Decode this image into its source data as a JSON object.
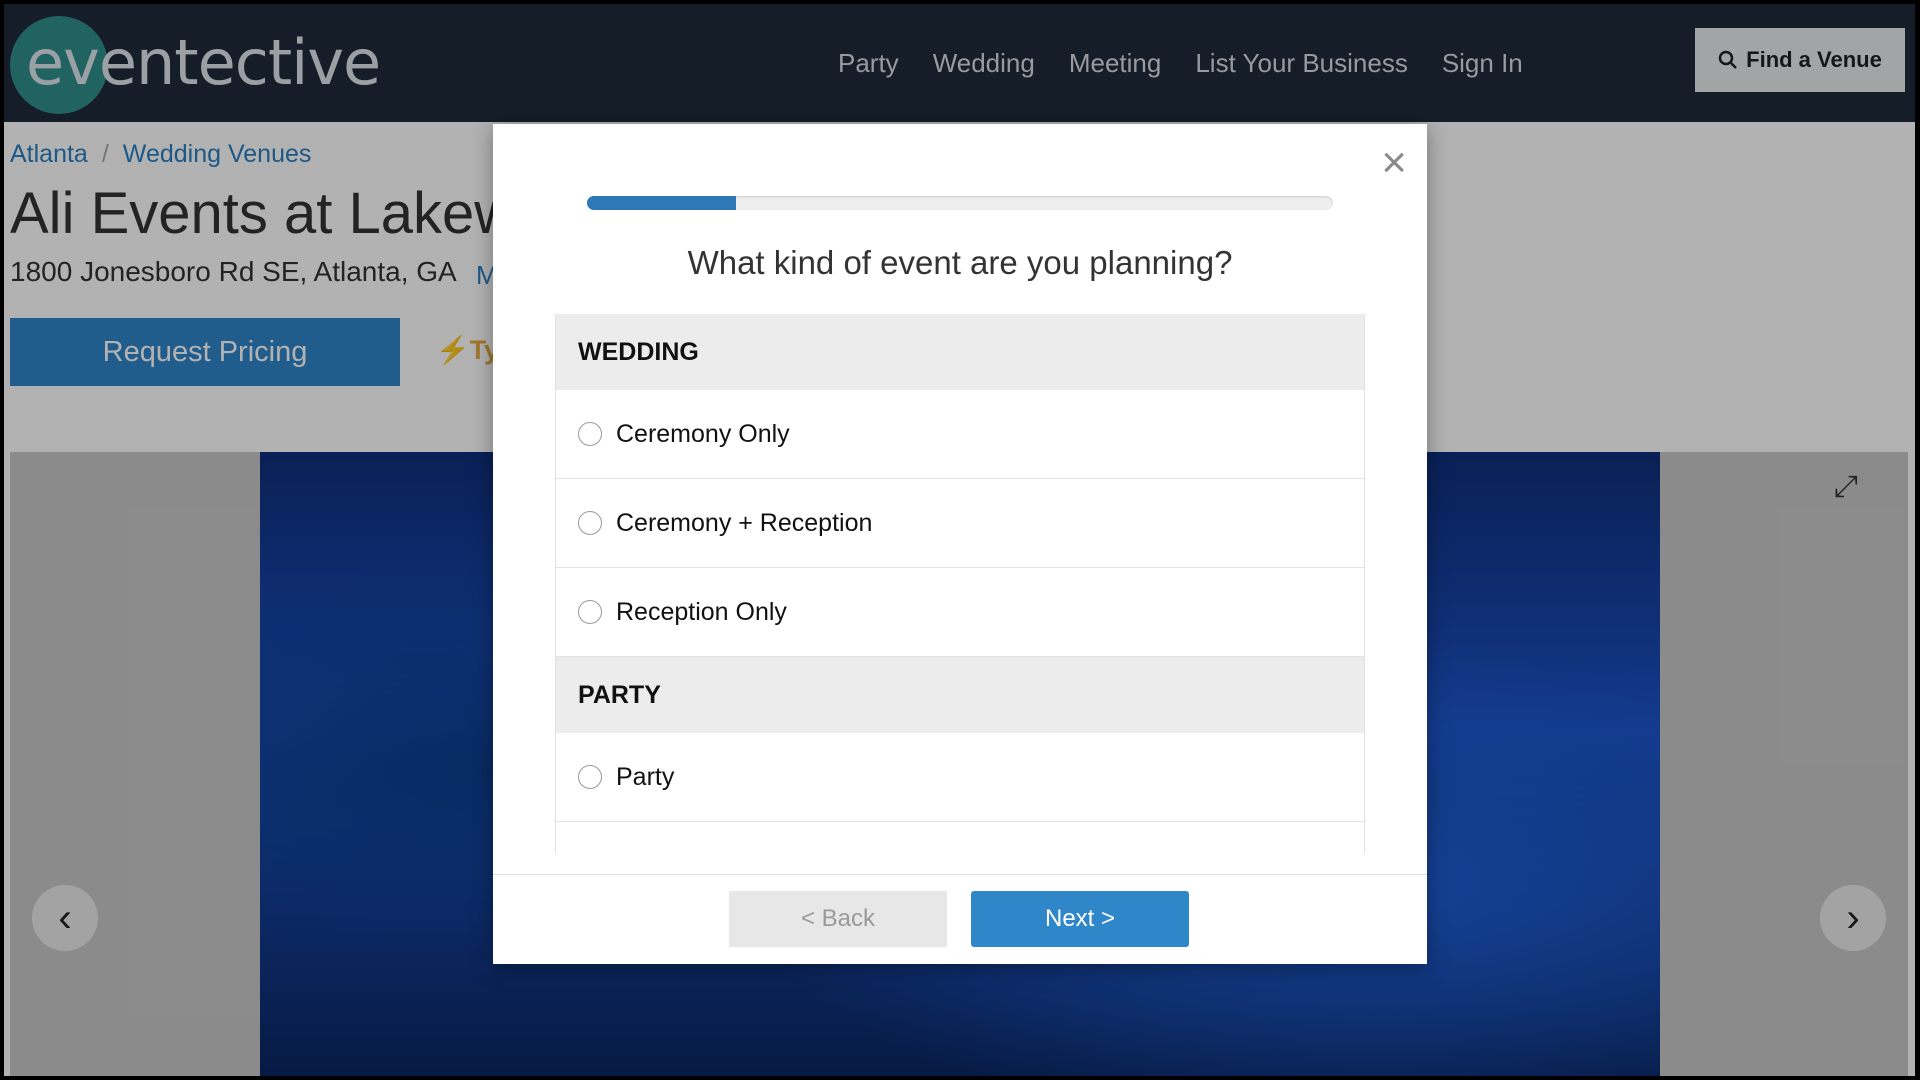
{
  "brand": {
    "logo_text": "eventective",
    "accent": "#2f8f8a"
  },
  "nav": {
    "items": [
      "Party",
      "Wedding",
      "Meeting",
      "List Your Business",
      "Sign In"
    ],
    "find_label": "Find a Venue"
  },
  "breadcrumb": {
    "items": [
      "Atlanta",
      "Wedding Venues"
    ],
    "separator": "/"
  },
  "venue": {
    "title": "Ali Events at Lakewo",
    "address": "1800 Jonesboro Rd SE, Atlanta, GA",
    "map_fragment": "M",
    "request_label": "Request Pricing",
    "typ_label": "Typ"
  },
  "modal": {
    "close_label": "×",
    "progress_fraction": 0.2,
    "question": "What kind of event are you planning?",
    "groups": [
      {
        "header": "WEDDING",
        "options": [
          "Ceremony Only",
          "Ceremony + Reception",
          "Reception Only"
        ]
      },
      {
        "header": "PARTY",
        "options": [
          "Party"
        ]
      }
    ],
    "back_label": "< Back",
    "next_label": "Next >"
  },
  "gallery": {
    "prev_symbol": "‹",
    "next_symbol": "›",
    "expand_symbol": "⤢"
  }
}
